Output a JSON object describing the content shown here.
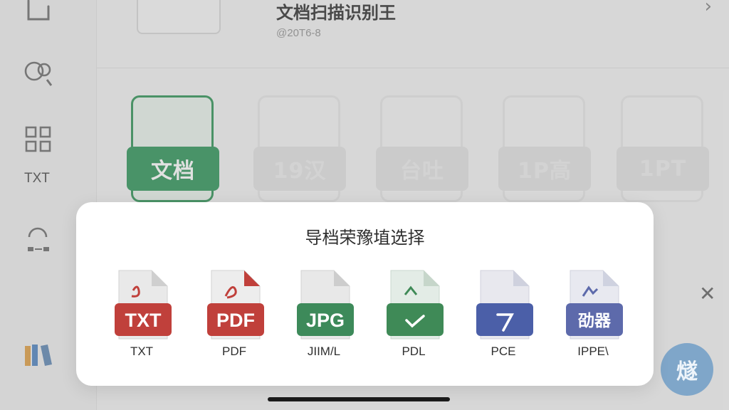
{
  "header": {
    "title": "文档扫描识别王",
    "subtitle": "@20T6-8"
  },
  "sidebar": {
    "icons": [
      "page-icon",
      "scan-search-icon",
      "qr-grid-icon",
      "swap-icon",
      "books-icon"
    ],
    "txt_label": "TXT"
  },
  "background_tiles": [
    {
      "label": "文档"
    },
    {
      "label": "19汉"
    },
    {
      "label": "台吐"
    },
    {
      "label": "1P高"
    },
    {
      "label": "1PT"
    }
  ],
  "modal": {
    "title": "导档荣豫埴选择",
    "formats": [
      {
        "tag": "TXT",
        "label": "TXT",
        "color": "#c0403b"
      },
      {
        "tag": "PDF",
        "label": "PDF",
        "color": "#c0403b"
      },
      {
        "tag": "JPG",
        "label": "JIIM/L",
        "color": "#3d8a5a"
      },
      {
        "tag": "",
        "label": "PDL",
        "color": "#3f8a57"
      },
      {
        "tag": "",
        "label": "PCE",
        "color": "#4b5fa8"
      },
      {
        "tag": "劭器",
        "label": "IPPE\\",
        "color": "#5d6aab"
      }
    ]
  },
  "side_close_symbol": "✕",
  "fab_label": "燧"
}
